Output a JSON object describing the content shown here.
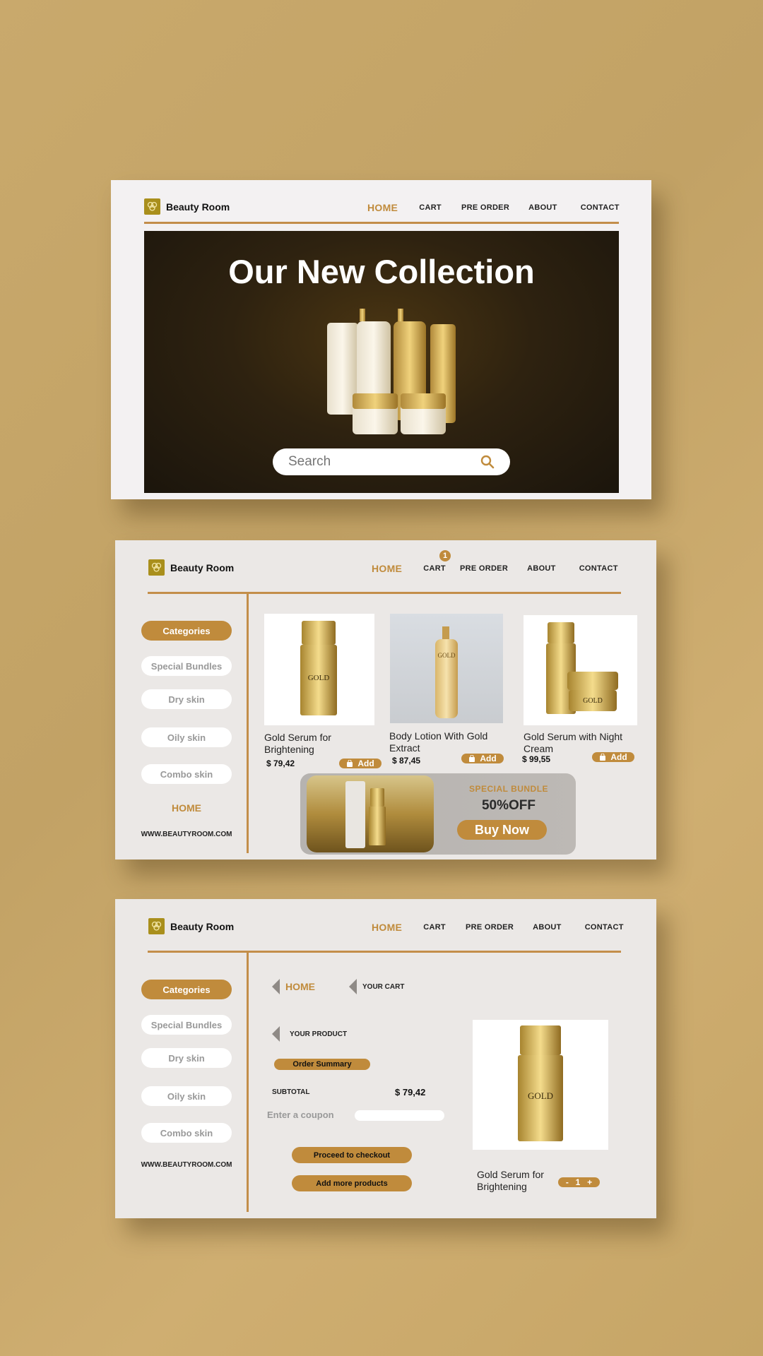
{
  "brand": {
    "name": "Beauty Room"
  },
  "nav": {
    "home": "HOME",
    "cart": "CART",
    "preorder": "PRE ORDER",
    "about": "ABOUT",
    "contact": "CONTACT",
    "cart_badge": "1"
  },
  "hero": {
    "title": "Our New Collection",
    "search_placeholder": "Search"
  },
  "sidebar": {
    "categories": "Categories",
    "items": [
      "Special Bundles",
      "Dry skin",
      "Oily  skin",
      "Combo skin"
    ],
    "home": "HOME",
    "url": "WWW.BEAUTYROOM.COM"
  },
  "products": [
    {
      "name_line1": "Gold Serum for",
      "name_line2": "Brightening",
      "price": "$ 79,42",
      "add": "Add"
    },
    {
      "name_line1": "Body Lotion With Gold",
      "name_line2": "Extract",
      "price": "$ 87,45",
      "add": "Add"
    },
    {
      "name_line1": "Gold Serum with Night",
      "name_line2": "Cream",
      "price": "$ 99,55",
      "add": "Add"
    }
  ],
  "bundle": {
    "label": "SPECIAL BUNDLE",
    "discount": "50%OFF",
    "cta": "Buy Now"
  },
  "cart_page": {
    "crumb_home": "HOME",
    "crumb_cart": "YOUR CART",
    "crumb_product": "YOUR PRODUCT",
    "order_summary": "Order Summary",
    "subtotal_label": "SUBTOTAL",
    "subtotal_value": "$ 79,42",
    "coupon_label": "Enter a coupon",
    "checkout": "Proceed to checkout",
    "add_more": "Add more products",
    "product_line1": "Gold Serum for",
    "product_line2": "Brightening",
    "qty_minus": "-",
    "qty_value": "1",
    "qty_plus": "+"
  },
  "colors": {
    "accent": "#c08b3c",
    "background": "#c6a566",
    "panel": "#ebe8e6",
    "logo": "#a98f1c"
  }
}
